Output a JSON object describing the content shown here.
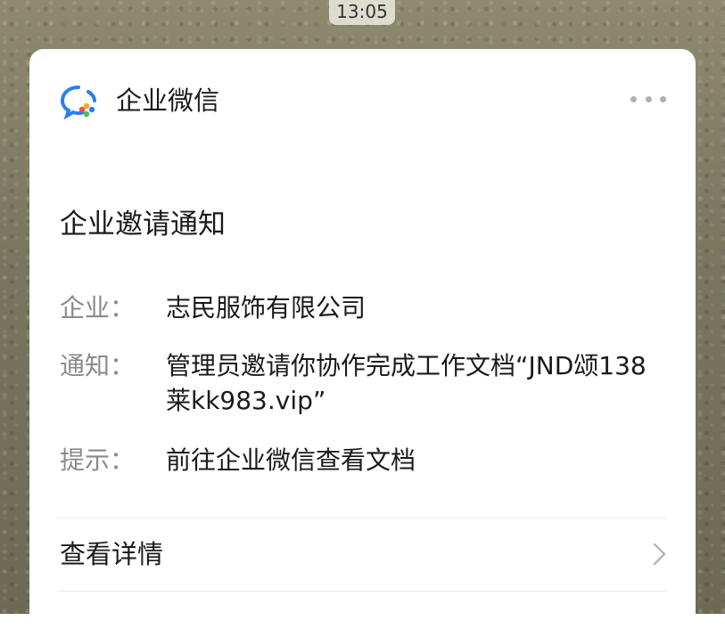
{
  "status_bar": {
    "time": "13:05"
  },
  "header": {
    "app_name": "企业微信",
    "logo_icon": "wecom-logo-icon",
    "more_icon": "more-dots-icon"
  },
  "notice": {
    "title": "企业邀请通知",
    "fields": [
      {
        "label": "企业：",
        "value": "志民服饰有限公司"
      },
      {
        "label": "通知：",
        "value": "管理员邀请你协作完成工作文档“JND颂138莱kk983.vip”"
      },
      {
        "label": "提示：",
        "value": "前往企业微信查看文档"
      }
    ]
  },
  "actions": {
    "details_label": "查看详情",
    "details_icon": "chevron-right-icon"
  },
  "colors": {
    "card_bg": "#ffffff",
    "label_gray": "#8a8a8a",
    "text_dark": "#1a1a1a",
    "logo_blue": "#2a7ef5",
    "logo_orange": "#f5a623",
    "logo_green": "#45c35b"
  }
}
